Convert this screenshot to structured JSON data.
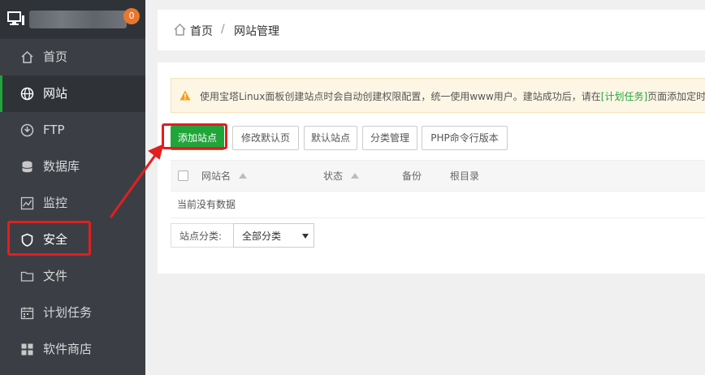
{
  "sidebar": {
    "badge": "0",
    "items": [
      {
        "label": "首页",
        "icon": "home-icon"
      },
      {
        "label": "网站",
        "icon": "globe-icon"
      },
      {
        "label": "FTP",
        "icon": "ftp-icon"
      },
      {
        "label": "数据库",
        "icon": "database-icon"
      },
      {
        "label": "监控",
        "icon": "monitor-chart-icon"
      },
      {
        "label": "安全",
        "icon": "shield-icon"
      },
      {
        "label": "文件",
        "icon": "folder-icon"
      },
      {
        "label": "计划任务",
        "icon": "calendar-icon"
      },
      {
        "label": "软件商店",
        "icon": "apps-icon"
      }
    ]
  },
  "breadcrumb": {
    "home": "首页",
    "separator": "/",
    "current": "网站管理"
  },
  "notice": {
    "text_before": "使用宝塔Linux面板创建站点时会自动创建权限配置，统一使用www用户。建站成功后，请在",
    "link": "[计划任务]",
    "text_after": "页面添加定时备"
  },
  "toolbar": {
    "add_site": "添加站点",
    "edit_default_page": "修改默认页",
    "default_site": "默认站点",
    "category_manage": "分类管理",
    "php_cli_version": "PHP命令行版本"
  },
  "table": {
    "columns": [
      "网站名",
      "状态",
      "备份",
      "根目录"
    ],
    "empty_text": "当前没有数据"
  },
  "category_filter": {
    "label": "站点分类:",
    "selected": "全部分类"
  },
  "colors": {
    "sidebar": "#3b3f45",
    "accent": "#20a53a",
    "highlight": "#e11f1f"
  }
}
